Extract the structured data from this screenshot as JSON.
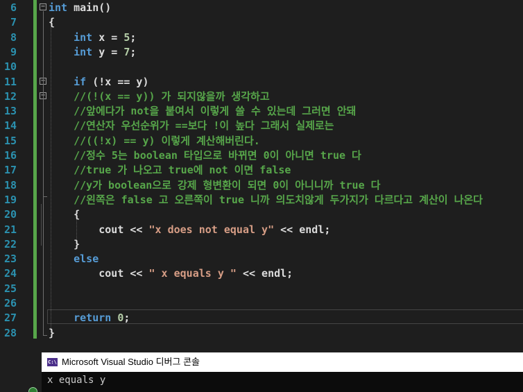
{
  "editor": {
    "lines": [
      {
        "num": "6",
        "tokens": [
          {
            "t": "int",
            "c": "kw"
          },
          {
            "t": " main()",
            "c": ""
          }
        ]
      },
      {
        "num": "7",
        "tokens": [
          {
            "t": "{",
            "c": ""
          }
        ]
      },
      {
        "num": "8",
        "tokens": [
          {
            "t": "    ",
            "c": ""
          },
          {
            "t": "int",
            "c": "kw"
          },
          {
            "t": " x = ",
            "c": ""
          },
          {
            "t": "5",
            "c": "num"
          },
          {
            "t": ";",
            "c": ""
          }
        ]
      },
      {
        "num": "9",
        "tokens": [
          {
            "t": "    ",
            "c": ""
          },
          {
            "t": "int",
            "c": "kw"
          },
          {
            "t": " y = ",
            "c": ""
          },
          {
            "t": "7",
            "c": "num"
          },
          {
            "t": ";",
            "c": ""
          }
        ]
      },
      {
        "num": "10",
        "tokens": []
      },
      {
        "num": "11",
        "tokens": [
          {
            "t": "    ",
            "c": ""
          },
          {
            "t": "if",
            "c": "kw"
          },
          {
            "t": " (!x == y)",
            "c": ""
          }
        ]
      },
      {
        "num": "12",
        "tokens": [
          {
            "t": "    ",
            "c": ""
          },
          {
            "t": "//(!(x == y)) 가 되지않을까 생각하고",
            "c": "cm"
          }
        ]
      },
      {
        "num": "13",
        "tokens": [
          {
            "t": "    ",
            "c": ""
          },
          {
            "t": "//앞에다가 not을 붙여서 이렇게 쓸 수 있는데 그러면 안돼",
            "c": "cm"
          }
        ]
      },
      {
        "num": "14",
        "tokens": [
          {
            "t": "    ",
            "c": ""
          },
          {
            "t": "//연산자 우선순위가 ==보다 !이 높다 그래서 실제로는",
            "c": "cm"
          }
        ]
      },
      {
        "num": "15",
        "tokens": [
          {
            "t": "    ",
            "c": ""
          },
          {
            "t": "//((!x) == y) 이렇게 계산해버린다.",
            "c": "cm"
          }
        ]
      },
      {
        "num": "16",
        "tokens": [
          {
            "t": "    ",
            "c": ""
          },
          {
            "t": "//정수 5는 boolean 타입으로 바뀌면 0이 아니면 true 다",
            "c": "cm"
          }
        ]
      },
      {
        "num": "17",
        "tokens": [
          {
            "t": "    ",
            "c": ""
          },
          {
            "t": "//true 가 나오고 true에 not 이면 false",
            "c": "cm"
          }
        ]
      },
      {
        "num": "18",
        "tokens": [
          {
            "t": "    ",
            "c": ""
          },
          {
            "t": "//y가 boolean으로 강제 형변환이 되면 0이 아니니까 true 다",
            "c": "cm"
          }
        ]
      },
      {
        "num": "19",
        "tokens": [
          {
            "t": "    ",
            "c": ""
          },
          {
            "t": "//왼쪽은 false 고 오른쪽이 true 니까 의도치않게 두가지가 다르다고 계산이 나온다",
            "c": "cm"
          }
        ]
      },
      {
        "num": "20",
        "tokens": [
          {
            "t": "    {",
            "c": ""
          }
        ]
      },
      {
        "num": "21",
        "tokens": [
          {
            "t": "        cout << ",
            "c": ""
          },
          {
            "t": "\"x does not equal y\"",
            "c": "str"
          },
          {
            "t": " << endl;",
            "c": ""
          }
        ]
      },
      {
        "num": "22",
        "tokens": [
          {
            "t": "    }",
            "c": ""
          }
        ]
      },
      {
        "num": "23",
        "tokens": [
          {
            "t": "    ",
            "c": ""
          },
          {
            "t": "else",
            "c": "kw"
          }
        ]
      },
      {
        "num": "24",
        "tokens": [
          {
            "t": "        cout << ",
            "c": ""
          },
          {
            "t": "\" x equals y \"",
            "c": "str"
          },
          {
            "t": " << endl;",
            "c": ""
          }
        ]
      },
      {
        "num": "25",
        "tokens": []
      },
      {
        "num": "26",
        "tokens": []
      },
      {
        "num": "27",
        "tokens": [
          {
            "t": "    ",
            "c": ""
          },
          {
            "t": "return",
            "c": "kw"
          },
          {
            "t": " ",
            "c": ""
          },
          {
            "t": "0",
            "c": "num"
          },
          {
            "t": ";",
            "c": ""
          }
        ]
      },
      {
        "num": "28",
        "tokens": [
          {
            "t": "}",
            "c": ""
          }
        ]
      }
    ]
  },
  "console": {
    "title": "Microsoft Visual Studio 디버그 콘솔",
    "icon_text": "C:\\",
    "output": "x equals y"
  },
  "colors": {
    "keyword": "#569cd6",
    "comment": "#57a64a",
    "string": "#d69d85",
    "line_number": "#2b91af",
    "change_bar": "#57a64a"
  }
}
